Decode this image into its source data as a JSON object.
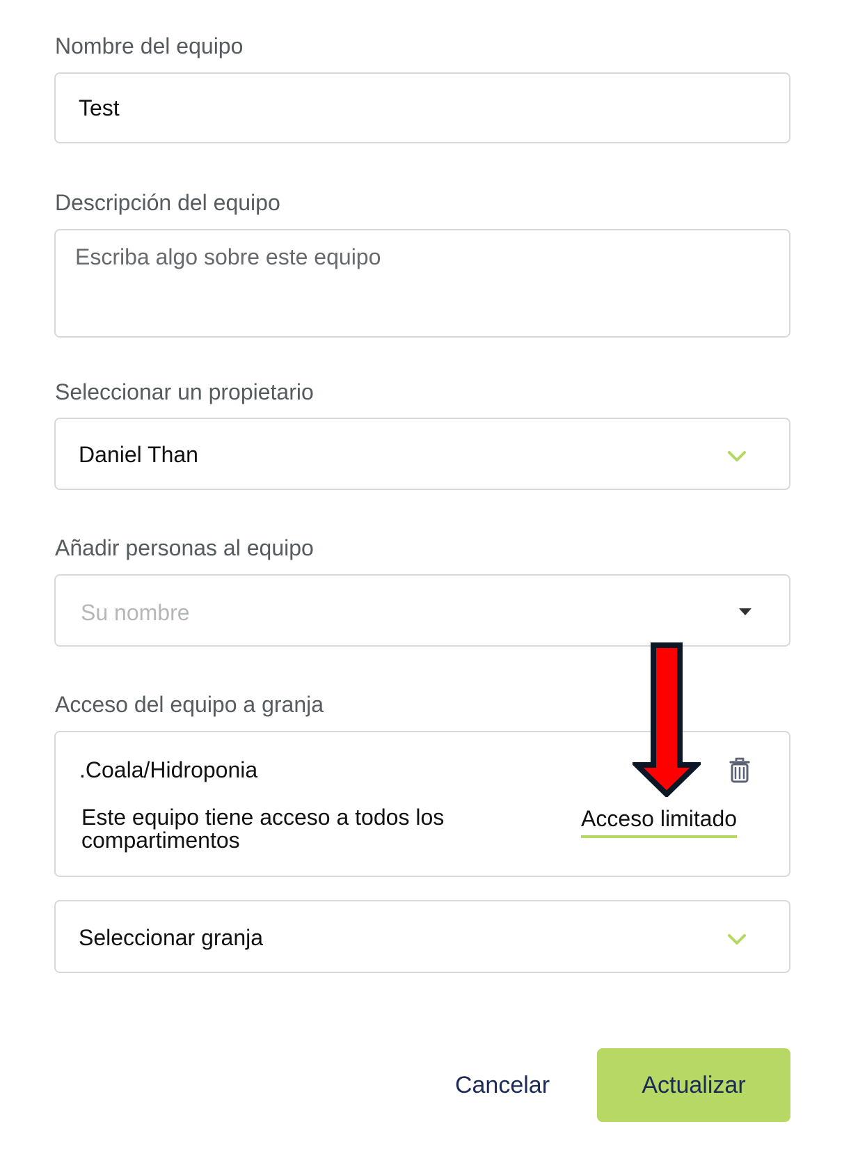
{
  "form": {
    "team_name": {
      "label": "Nombre del equipo",
      "value": "Test"
    },
    "team_description": {
      "label": "Descripción del equipo",
      "placeholder": "Escriba algo sobre este equipo"
    },
    "owner": {
      "label": "Seleccionar un propietario",
      "value": "Daniel Than",
      "icon": "chevron-down-icon"
    },
    "add_people": {
      "label": "Añadir personas al equipo",
      "placeholder": "Su nombre",
      "icon": "caret-down-icon"
    },
    "farm_access": {
      "label": "Acceso del equipo a granja",
      "entry": {
        "farm_path": ".Coala/Hidroponia",
        "description": "Este equipo tiene acceso a todos los compartimentos",
        "access_link": "Acceso limitado",
        "delete_icon": "trash-icon"
      },
      "select_farm": {
        "value": "Seleccionar granja",
        "icon": "chevron-down-icon"
      }
    }
  },
  "actions": {
    "cancel_label": "Cancelar",
    "submit_label": "Actualizar"
  },
  "annotation": {
    "arrow_icon": "red-arrow-down-icon"
  },
  "colors": {
    "accent_green": "#b7d864",
    "chevron_green": "#b4d860",
    "button_text": "#1a2b5a",
    "annotation_red": "#ff0000"
  }
}
